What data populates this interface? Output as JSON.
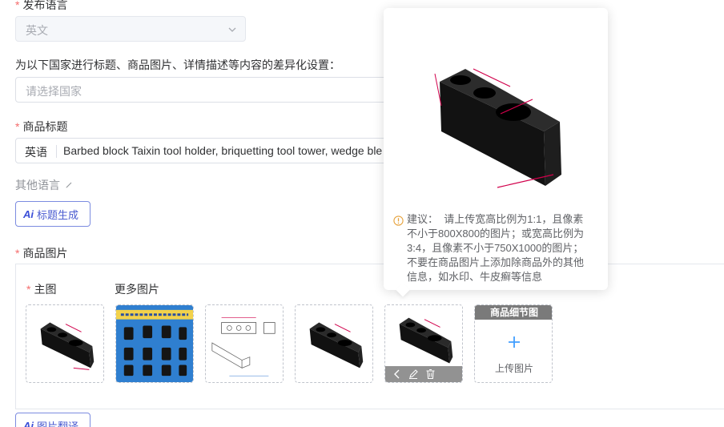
{
  "language_field": {
    "label": "发布语言",
    "value": "英文"
  },
  "country_field": {
    "label": "为以下国家进行标题、商品图片、详情描述等内容的差异化设置：",
    "placeholder": "请选择国家"
  },
  "title_field": {
    "label": "商品标题",
    "lang_tag": "英语",
    "value": "Barbed block Taixin tool holder, briquetting tool tower, wedge ble",
    "other_languages": "其他语言",
    "ai_button": "标题生成"
  },
  "images_section": {
    "label": "商品图片",
    "main_label": "主图",
    "more_label": "更多图片",
    "detail_badge": "商品细节图",
    "upload_label": "上传图片",
    "translate_button": "图片翻译",
    "thumbnail_count": 5
  },
  "popover": {
    "tip_title": "建议：",
    "tip_lines": [
      "请上传宽高比例为1:1，且像素",
      "不小于800X800的图片；或宽高比例为",
      "3:4，且像素不小于750X1000的图片；",
      "不要在商品图片上添加除商品外的其他",
      "信息，如水印、牛皮癣等信息"
    ]
  },
  "icons": [
    "chevron-down-icon",
    "edit-pencil-icon",
    "info-icon",
    "chevron-left-icon",
    "edit-icon",
    "delete-icon",
    "plus-icon"
  ],
  "colors": {
    "required": "#f56c6c",
    "ai_accent": "#3b4fd8",
    "info": "#e6a23c",
    "blue_link": "#409eff"
  }
}
